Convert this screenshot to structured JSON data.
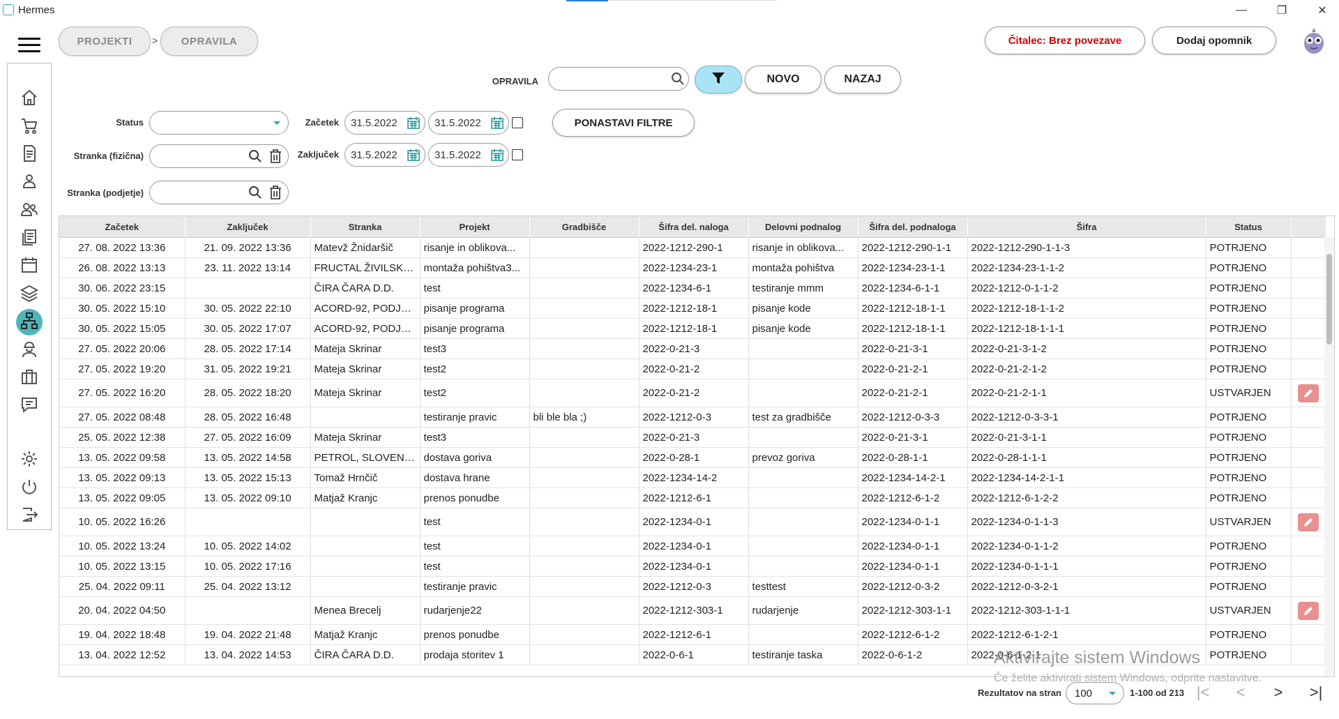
{
  "window": {
    "title": "Hermes",
    "minimize": "—",
    "restore": "❐",
    "close": "✕"
  },
  "breadcrumb": {
    "items": [
      "PROJEKTI",
      "OPRAVILA"
    ],
    "separator": ">"
  },
  "header": {
    "reader_status": "Čitalec: Brez povezave",
    "reader_status_color": "#d00000",
    "add_reminder": "Dodaj opomnik"
  },
  "sidebar": {
    "icons": [
      "home-icon",
      "cart-icon",
      "invoice-icon",
      "person-icon",
      "people-icon",
      "documents-icon",
      "calendar-icon",
      "layers-icon",
      "hierarchy-icon",
      "worker-icon",
      "briefcase-icon",
      "chat-icon",
      "gear-icon",
      "power-icon",
      "logout-icon"
    ],
    "active": "hierarchy-icon",
    "accent": "#4fb6b8"
  },
  "toolbar": {
    "search_label": "OPRAVILA",
    "search_value": "",
    "new_label": "NOVO",
    "back_label": "NAZAJ",
    "filter_color": "#a8e4f5"
  },
  "filters": {
    "status_label": "Status",
    "status_value": "",
    "start_label": "Začetek",
    "start_from": "31.5.2022",
    "start_to": "31.5.2022",
    "end_label": "Zaključek",
    "end_from": "31.5.2022",
    "end_to": "31.5.2022",
    "client_physical_label": "Stranka (fizična)",
    "client_company_label": "Stranka (podjetje)",
    "reset_label": "PONASTAVI FILTRE"
  },
  "table": {
    "columns": [
      "Začetek",
      "Zaključek",
      "Stranka",
      "Projekt",
      "Gradbišče",
      "Šifra del. naloga",
      "Delovni podnalog",
      "Šifra del. podnaloga",
      "Šifra",
      "Status"
    ],
    "rows": [
      [
        "27. 08. 2022 13:36",
        "21. 09. 2022 13:36",
        "Matevž Žnidaršič",
        "risanje in oblikova...",
        "",
        "2022-1212-290-1",
        "risanje in oblikova...",
        "2022-1212-290-1-1",
        "2022-1212-290-1-1-3",
        "POTRJENO",
        false
      ],
      [
        "26. 08. 2022 13:13",
        "23. 11. 2022 13:14",
        "FRUCTAL ŽIVILSKA ...",
        "montaža pohištva3...",
        "",
        "2022-1234-23-1",
        "montaža pohištva",
        "2022-1234-23-1-1",
        "2022-1234-23-1-1-2",
        "POTRJENO",
        false
      ],
      [
        "30. 06. 2022 23:15",
        "",
        "ČIRA ČARA D.D.",
        "test",
        "",
        "2022-1234-6-1",
        "testiranje mmm",
        "2022-1234-6-1-1",
        "2022-1212-0-1-1-2",
        "POTRJENO",
        false
      ],
      [
        "30. 05. 2022 15:10",
        "30. 05. 2022 22:10",
        "ACORD-92, PODJET...",
        "pisanje programa",
        "",
        "2022-1212-18-1",
        "pisanje kode",
        "2022-1212-18-1-1",
        "2022-1212-18-1-1-2",
        "POTRJENO",
        false
      ],
      [
        "30. 05. 2022 15:05",
        "30. 05. 2022 17:07",
        "ACORD-92, PODJET...",
        "pisanje programa",
        "",
        "2022-1212-18-1",
        "pisanje kode",
        "2022-1212-18-1-1",
        "2022-1212-18-1-1-1",
        "POTRJENO",
        false
      ],
      [
        "27. 05. 2022 20:06",
        "28. 05. 2022 17:14",
        "Mateja Skrinar",
        "test3",
        "",
        "2022-0-21-3",
        "",
        "2022-0-21-3-1",
        "2022-0-21-3-1-2",
        "POTRJENO",
        false
      ],
      [
        "27. 05. 2022 19:20",
        "31. 05. 2022 19:21",
        "Mateja Skrinar",
        "test2",
        "",
        "2022-0-21-2",
        "",
        "2022-0-21-2-1",
        "2022-0-21-2-1-2",
        "POTRJENO",
        false
      ],
      [
        "27. 05. 2022 16:20",
        "28. 05. 2022 18:20",
        "Mateja Skrinar",
        "test2",
        "",
        "2022-0-21-2",
        "",
        "2022-0-21-2-1",
        "2022-0-21-2-1-1",
        "USTVARJEN",
        true
      ],
      [
        "27. 05. 2022 08:48",
        "28. 05. 2022 16:48",
        "",
        "testiranje pravic",
        "bli ble bla ;)",
        "2022-1212-0-3",
        "test za gradbišče",
        "2022-1212-0-3-3",
        "2022-1212-0-3-3-1",
        "POTRJENO",
        false
      ],
      [
        "25. 05. 2022 12:38",
        "27. 05. 2022 16:09",
        "Mateja Skrinar",
        "test3",
        "",
        "2022-0-21-3",
        "",
        "2022-0-21-3-1",
        "2022-0-21-3-1-1",
        "POTRJENO",
        false
      ],
      [
        "13. 05. 2022 09:58",
        "13. 05. 2022 14:58",
        "PETROL, SLOVENS...",
        "dostava goriva",
        "",
        "2022-0-28-1",
        "prevoz goriva",
        "2022-0-28-1-1",
        "2022-0-28-1-1-1",
        "POTRJENO",
        false
      ],
      [
        "13. 05. 2022 09:13",
        "13. 05. 2022 15:13",
        "Tomaž Hrnčič",
        "dostava hrane",
        "",
        "2022-1234-14-2",
        "",
        "2022-1234-14-2-1",
        "2022-1234-14-2-1-1",
        "POTRJENO",
        false
      ],
      [
        "13. 05. 2022 09:05",
        "13. 05. 2022 09:10",
        "Matjaž Kranjc",
        "prenos ponudbe",
        "",
        "2022-1212-6-1",
        "",
        "2022-1212-6-1-2",
        "2022-1212-6-1-2-2",
        "POTRJENO",
        false
      ],
      [
        "10. 05. 2022 16:26",
        "",
        "",
        "test",
        "",
        "2022-1234-0-1",
        "",
        "2022-1234-0-1-1",
        "2022-1234-0-1-1-3",
        "USTVARJEN",
        true
      ],
      [
        "10. 05. 2022 13:24",
        "10. 05. 2022 14:02",
        "",
        "test",
        "",
        "2022-1234-0-1",
        "",
        "2022-1234-0-1-1",
        "2022-1234-0-1-1-2",
        "POTRJENO",
        false
      ],
      [
        "10. 05. 2022 13:15",
        "10. 05. 2022 17:16",
        "",
        "test",
        "",
        "2022-1234-0-1",
        "",
        "2022-1234-0-1-1",
        "2022-1234-0-1-1-1",
        "POTRJENO",
        false
      ],
      [
        "25. 04. 2022 09:11",
        "25. 04. 2022 13:12",
        "",
        "testiranje pravic",
        "",
        "2022-1212-0-3",
        "testtest",
        "2022-1212-0-3-2",
        "2022-1212-0-3-2-1",
        "POTRJENO",
        false
      ],
      [
        "20. 04. 2022 04:50",
        "",
        "Menea Brecelj",
        "rudarjenje22",
        "",
        "2022-1212-303-1",
        "rudarjenje",
        "2022-1212-303-1-1",
        "2022-1212-303-1-1-1",
        "USTVARJEN",
        true
      ],
      [
        "19. 04. 2022 18:48",
        "19. 04. 2022 21:48",
        "Matjaž Kranjc",
        "prenos ponudbe",
        "",
        "2022-1212-6-1",
        "",
        "2022-1212-6-1-2",
        "2022-1212-6-1-2-1",
        "POTRJENO",
        false
      ],
      [
        "13. 04. 2022 12:52",
        "13. 04. 2022 14:53",
        "ČIRA ČARA D.D.",
        "prodaja storitev 1",
        "",
        "2022-0-6-1",
        "testiranje taska",
        "2022-0-6-1-2",
        "2022-0-6-1-2-1",
        "POTRJENO",
        false
      ]
    ]
  },
  "pager": {
    "label": "Rezultatov na stran",
    "page_size": "100",
    "range": "1-100 od 213",
    "first": "|<",
    "prev": "<",
    "next": ">",
    "last": ">|"
  },
  "watermark": {
    "line1": "Aktivirajte sistem Windows",
    "line2": "Če želite aktivirati sistem Windows, odprite nastavitve."
  }
}
